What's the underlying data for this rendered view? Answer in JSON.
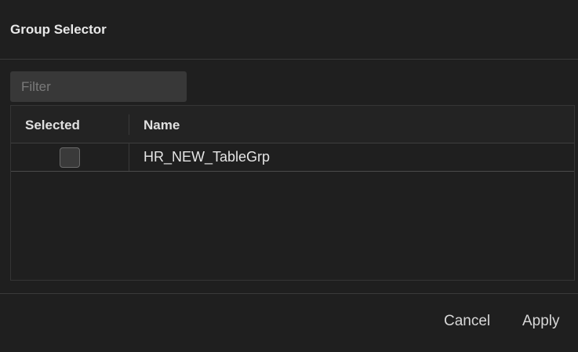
{
  "dialog": {
    "title": "Group Selector"
  },
  "filter": {
    "placeholder": "Filter",
    "value": ""
  },
  "table": {
    "columns": [
      "Selected",
      "Name"
    ],
    "rows": [
      {
        "selected": false,
        "name": "HR_NEW_TableGrp"
      }
    ]
  },
  "footer": {
    "cancel_label": "Cancel",
    "apply_label": "Apply"
  }
}
